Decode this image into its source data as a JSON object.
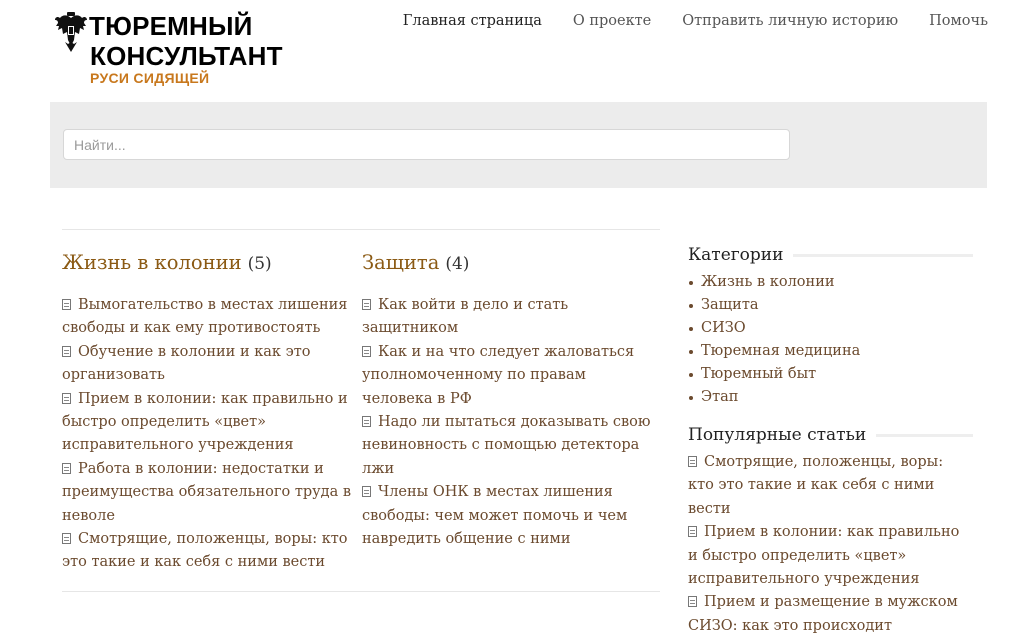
{
  "logo": {
    "line1": "ТЮРЕМНЫЙ",
    "line2": "КОНСУЛЬТАНТ",
    "tagline": "РУСИ СИДЯЩЕЙ",
    "emblem_icon": "double-headed-eagle-icon"
  },
  "nav": {
    "items": [
      {
        "label": "Главная страница"
      },
      {
        "label": "О проекте"
      },
      {
        "label": "Отправить личную историю"
      },
      {
        "label": "Помочь"
      }
    ]
  },
  "search": {
    "placeholder": "Найти...",
    "value": ""
  },
  "categories": [
    {
      "title": "Жизнь в колонии",
      "count": "(5)",
      "articles": [
        "Вымогательство в местах лишения свободы и как ему противостоять",
        "Обучение в колонии и как это организовать",
        "Прием в колонии: как правильно и быстро определить «цвет» исправительного учреждения",
        "Работа в колонии: недостатки и преимущества обязательного труда в неволе",
        "Смотрящие, положенцы, воры: кто это такие и как себя с ними вести"
      ]
    },
    {
      "title": "Защита",
      "count": "(4)",
      "articles": [
        "Как войти в дело и стать защитником",
        "Как и на что следует жаловаться уполномоченному по правам человека в РФ",
        "Надо ли пытаться доказывать свою невиновность с помощью детектора лжи",
        "Члены ОНК в местах лишения свободы: чем может помочь и чем навредить общение с ними"
      ]
    }
  ],
  "sidebar": {
    "categories_title": "Категории",
    "categories": [
      "Жизнь в колонии",
      "Защита",
      "СИЗО",
      "Тюремная медицина",
      "Тюремный быт",
      "Этап"
    ],
    "popular_title": "Популярные статьи",
    "popular": [
      "Смотрящие, положенцы, воры: кто это такие и как себя с ними вести",
      "Прием в колонии: как правильно и быстро определить «цвет» исправительного учреждения",
      "Прием и размещение в мужском СИЗО: как это происходит"
    ]
  },
  "colors": {
    "accent": "#8b5a14",
    "link": "#6b4a2e",
    "tagline": "#c8781d",
    "band": "#ececec"
  },
  "icons": {
    "article": "document-icon"
  }
}
